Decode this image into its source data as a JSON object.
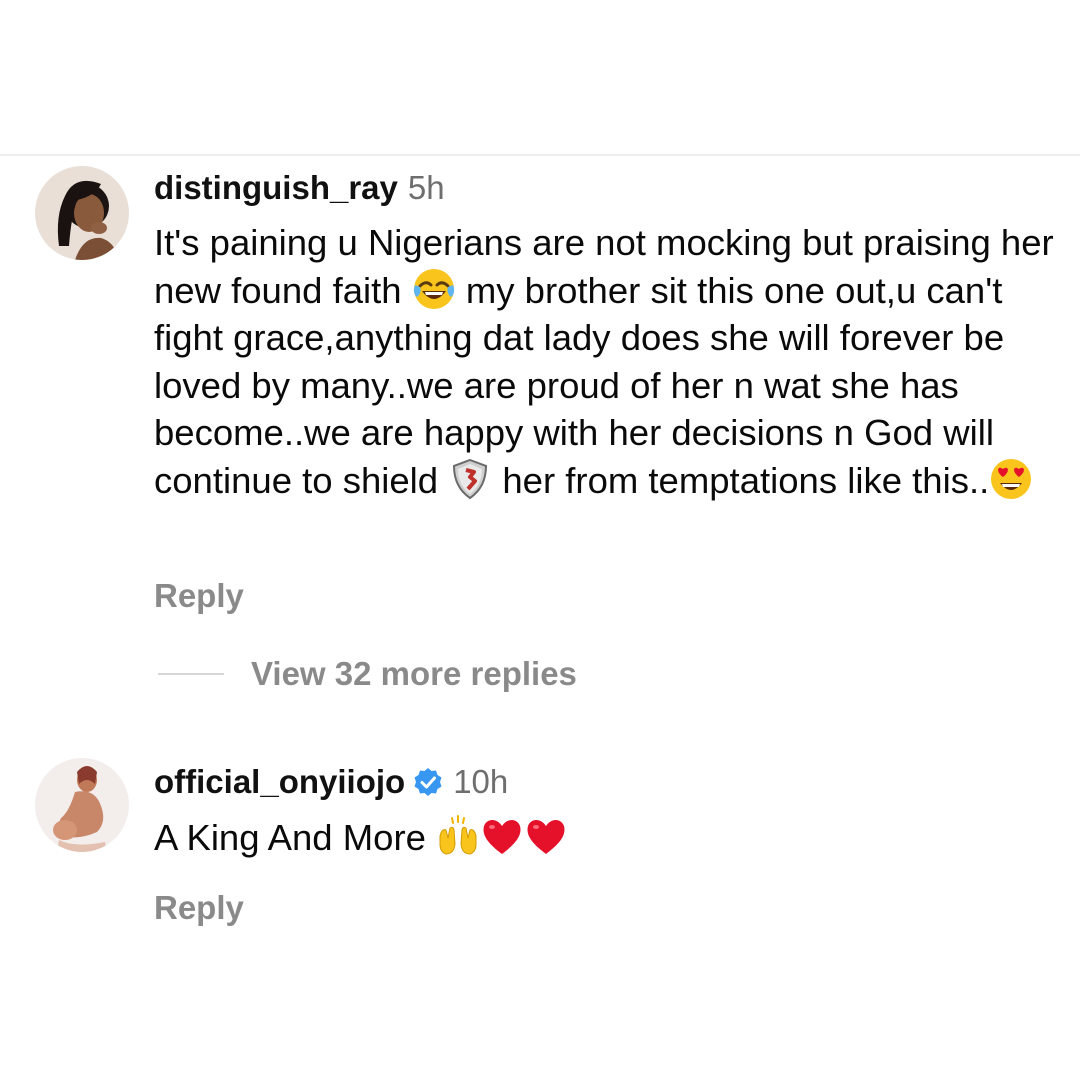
{
  "comments": [
    {
      "username": "distinguish_ray",
      "time": "5h",
      "text_parts": [
        "It's paining u Nigerians are not mocking but praising her new found faith ",
        " my brother sit this one out,u can't fight grace,anything dat lady does she will forever be loved by many..we are proud of her n wat she has become..we are happy with her decisions n God will continue to shield ",
        " her from temptations like this.."
      ],
      "emojis": [
        "face-with-tears-of-joy-icon",
        "shield-icon",
        "heart-eyes-icon"
      ],
      "reply_label": "Reply",
      "verified": false
    },
    {
      "username": "official_onyiiojo",
      "time": "10h",
      "text_parts": [
        "A King And More "
      ],
      "emojis": [
        "raising-hands-icon",
        "red-heart-icon",
        "red-heart-icon"
      ],
      "reply_label": "Reply",
      "verified": true
    }
  ],
  "view_replies_label": "View 32 more replies",
  "colors": {
    "text": "#0a0a0a",
    "secondary": "#8a8a8a",
    "timestamp": "#6e6e6e",
    "verified_badge": "#3897f0",
    "heart": "#e5112b"
  }
}
